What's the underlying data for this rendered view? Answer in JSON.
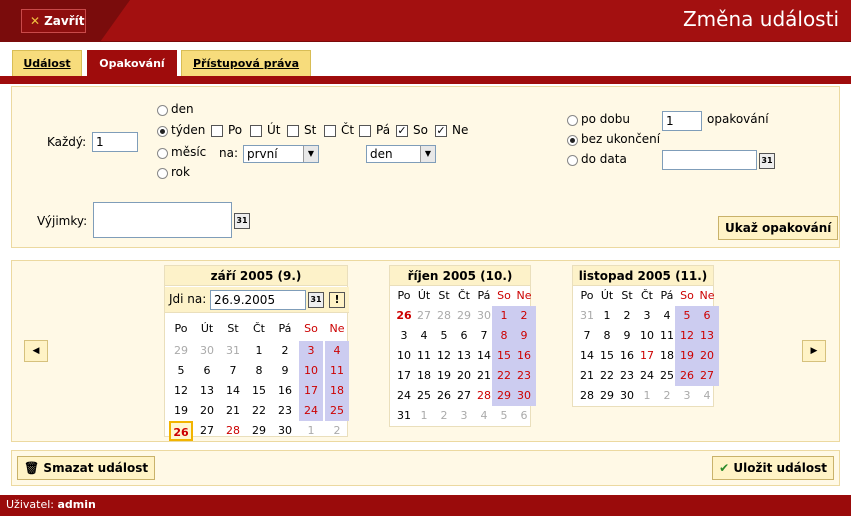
{
  "header": {
    "close_label": "Zavřít",
    "title": "Změna události"
  },
  "tabs": [
    "Událost",
    "Opakování",
    "Přístupová práva"
  ],
  "repeat": {
    "every_label": "Každý:",
    "every_value": "1",
    "period_options": [
      "den",
      "týden",
      "měsíc",
      "rok"
    ],
    "selected_period": "týden",
    "weekdays": [
      {
        "label": "Po",
        "checked": false
      },
      {
        "label": "Út",
        "checked": false
      },
      {
        "label": "St",
        "checked": false
      },
      {
        "label": "Čt",
        "checked": false
      },
      {
        "label": "Pá",
        "checked": false
      },
      {
        "label": "So",
        "checked": true
      },
      {
        "label": "Ne",
        "checked": true
      }
    ],
    "month_on_label": "na:",
    "month_which": "první",
    "month_day": "den",
    "duration_options": [
      "po dobu",
      "bez ukončení",
      "do data"
    ],
    "selected_duration": "bez ukončení",
    "count_value": "1",
    "count_unit": "opakování",
    "until_value": "",
    "exceptions_label": "Výjimky:",
    "show_button": "Ukaž opakování"
  },
  "calendars": [
    {
      "title": "září 2005 (9.)",
      "goto_label": "Jdi na:",
      "goto_value": "26.9.2005",
      "go_button": "!",
      "weekdays": [
        "Po",
        "Út",
        "St",
        "Čt",
        "Pá",
        "So",
        "Ne"
      ],
      "weeks": [
        [
          "29",
          "30",
          "31",
          "1",
          "2",
          "3",
          "4"
        ],
        [
          "5",
          "6",
          "7",
          "8",
          "9",
          "10",
          "11"
        ],
        [
          "12",
          "13",
          "14",
          "15",
          "16",
          "17",
          "18"
        ],
        [
          "19",
          "20",
          "21",
          "22",
          "23",
          "24",
          "25"
        ],
        [
          "26",
          "27",
          "28",
          "29",
          "30",
          "1",
          "2"
        ]
      ]
    },
    {
      "title": "říjen 2005 (10.)",
      "weekdays": [
        "Po",
        "Út",
        "St",
        "Čt",
        "Pá",
        "So",
        "Ne"
      ],
      "weeks": [
        [
          "26",
          "27",
          "28",
          "29",
          "30",
          "1",
          "2"
        ],
        [
          "3",
          "4",
          "5",
          "6",
          "7",
          "8",
          "9"
        ],
        [
          "10",
          "11",
          "12",
          "13",
          "14",
          "15",
          "16"
        ],
        [
          "17",
          "18",
          "19",
          "20",
          "21",
          "22",
          "23"
        ],
        [
          "24",
          "25",
          "26",
          "27",
          "28",
          "29",
          "30"
        ],
        [
          "31",
          "1",
          "2",
          "3",
          "4",
          "5",
          "6"
        ]
      ]
    },
    {
      "title": "listopad 2005 (11.)",
      "weekdays": [
        "Po",
        "Út",
        "St",
        "Čt",
        "Pá",
        "So",
        "Ne"
      ],
      "weeks": [
        [
          "31",
          "1",
          "2",
          "3",
          "4",
          "5",
          "6"
        ],
        [
          "7",
          "8",
          "9",
          "10",
          "11",
          "12",
          "13"
        ],
        [
          "14",
          "15",
          "16",
          "17",
          "18",
          "19",
          "20"
        ],
        [
          "21",
          "22",
          "23",
          "24",
          "25",
          "26",
          "27"
        ],
        [
          "28",
          "29",
          "30",
          "1",
          "2",
          "3",
          "4"
        ]
      ]
    }
  ],
  "actions": {
    "delete_label": "Smazat událost",
    "save_label": "Uložit událost"
  },
  "footer": {
    "user_label": "Uživatel:",
    "user_name": "admin"
  },
  "colors": {
    "brand": "#a31010",
    "tab_yellow": "#f7dc7c",
    "weekend": "#ccccf0",
    "panel": "#fff9e6"
  }
}
